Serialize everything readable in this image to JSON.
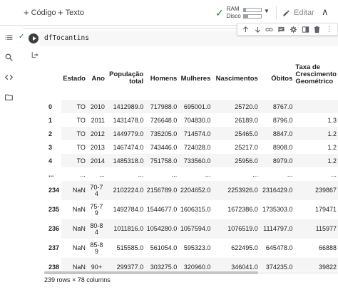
{
  "toolbar": {
    "add_code_label": "Código",
    "add_text_label": "Texto",
    "ram_label": "RAM",
    "disk_label": "Disco",
    "ram_usage": 0.15,
    "disk_usage": 0.25,
    "edit_label": "Editar"
  },
  "cell": {
    "code": "dfTocantins"
  },
  "table": {
    "columns": [
      "Estado",
      "Ano",
      "População total",
      "Homens",
      "Mulheres",
      "Nascimentos",
      "Óbitos",
      "Taxa de Crescimento Geométrico"
    ],
    "rows": [
      {
        "idx": "0",
        "cells": [
          "TO",
          "2010",
          "1412989.0",
          "717988.0",
          "695001.0",
          "25720.0",
          "8767.0",
          ""
        ]
      },
      {
        "idx": "1",
        "cells": [
          "TO",
          "2011",
          "1431478.0",
          "726648.0",
          "704830.0",
          "26189.0",
          "8796.0",
          "1.3"
        ]
      },
      {
        "idx": "2",
        "cells": [
          "TO",
          "2012",
          "1449779.0",
          "735205.0",
          "714574.0",
          "25465.0",
          "8847.0",
          "1.2"
        ]
      },
      {
        "idx": "3",
        "cells": [
          "TO",
          "2013",
          "1467474.0",
          "743446.0",
          "724028.0",
          "25217.0",
          "8908.0",
          "1.2"
        ]
      },
      {
        "idx": "4",
        "cells": [
          "TO",
          "2014",
          "1485318.0",
          "751758.0",
          "733560.0",
          "25956.0",
          "8979.0",
          "1.2"
        ]
      },
      {
        "idx": "...",
        "cells": [
          "...",
          "...",
          "...",
          "...",
          "...",
          "...",
          "...",
          "..."
        ]
      },
      {
        "idx": "234",
        "cells": [
          "NaN",
          "70-74",
          "2102224.0",
          "2156789.0",
          "2204652.0",
          "2253926.0",
          "2316429.0",
          "239867"
        ]
      },
      {
        "idx": "235",
        "cells": [
          "NaN",
          "75-79",
          "1492784.0",
          "1544677.0",
          "1606315.0",
          "1672386.0",
          "1735303.0",
          "179471"
        ]
      },
      {
        "idx": "236",
        "cells": [
          "NaN",
          "80-84",
          "1011816.0",
          "1054280.0",
          "1057594.0",
          "1076519.0",
          "1114797.0",
          "115977"
        ]
      },
      {
        "idx": "237",
        "cells": [
          "NaN",
          "85-89",
          "515585.0",
          "561054.0",
          "595323.0",
          "622495.0",
          "645478.0",
          "66888"
        ]
      },
      {
        "idx": "238",
        "cells": [
          "NaN",
          "90+",
          "299377.0",
          "303275.0",
          "320960.0",
          "346041.0",
          "374235.0",
          "39822"
        ]
      }
    ],
    "footer": "239 rows × 78 columns"
  },
  "icons": {
    "rail": [
      "toc-icon",
      "search-icon",
      "code-snippets-icon",
      "folder-icon"
    ],
    "cell_tools": [
      "move-up-icon",
      "move-down-icon",
      "link-icon",
      "comment-icon",
      "settings-icon",
      "mirror-icon",
      "delete-icon",
      "more-icon"
    ]
  }
}
